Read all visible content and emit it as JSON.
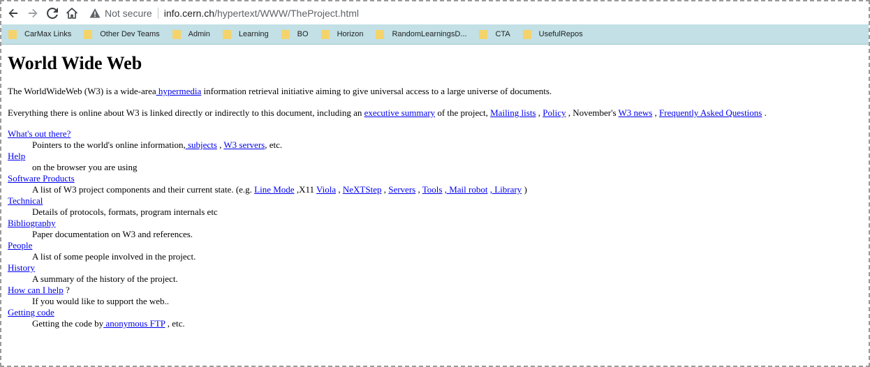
{
  "browser": {
    "security_label": "Not secure",
    "url_host": "info.cern.ch",
    "url_path": "/hypertext/WWW/TheProject.html"
  },
  "bookmarks": [
    {
      "label": "CarMax Links"
    },
    {
      "label": "Other Dev Teams"
    },
    {
      "label": "Admin"
    },
    {
      "label": "Learning"
    },
    {
      "label": "BO"
    },
    {
      "label": "Horizon"
    },
    {
      "label": "RandomLearningsD..."
    },
    {
      "label": "CTA"
    },
    {
      "label": "UsefulRepos"
    }
  ],
  "page": {
    "title": "World Wide Web",
    "intro": {
      "text_a": "The WorldWideWeb (W3) is a wide-area",
      "link_hypermedia": " hypermedia",
      "text_b": " information retrieval initiative aiming to give universal access to a large universe of documents."
    },
    "para2": {
      "text_a": "Everything there is online about W3 is linked directly or indirectly to this document, including an ",
      "link_exec": "executive summary",
      "text_b": " of the project, ",
      "link_mailing": "Mailing lists",
      "text_c": " , ",
      "link_policy": "Policy",
      "text_d": " , November's ",
      "link_news": "W3 news",
      "text_e": " , ",
      "link_faq": "Frequently Asked Questions",
      "text_f": " ."
    },
    "items": {
      "whats_out": {
        "term": "What's out there?",
        "desc_a": "Pointers to the world's online information,",
        "link_subjects": " subjects",
        "desc_b": " , ",
        "link_servers": "W3 servers",
        "desc_c": ", etc."
      },
      "help": {
        "term": "Help",
        "desc": "on the browser you are using"
      },
      "software": {
        "term": "Software Products",
        "desc_a": "A list of W3 project components and their current state. (e.g. ",
        "link_linemode": "Line Mode",
        "desc_b": " ,X11 ",
        "link_viola": "Viola",
        "sep1": " , ",
        "link_nextstep": "NeXTStep",
        "sep2": " , ",
        "link_servers": "Servers",
        "sep3": " , ",
        "link_tools": "Tools",
        "sep4": " ",
        "link_mailrobot": ", Mail robot",
        "sep5": " ",
        "link_library": ", Library",
        "desc_end": " )"
      },
      "technical": {
        "term": "Technical",
        "desc": "Details of protocols, formats, program internals etc"
      },
      "bibliography": {
        "term": "Bibliography",
        "desc": "Paper documentation on W3 and references."
      },
      "people": {
        "term": "People",
        "desc": "A list of some people involved in the project."
      },
      "history": {
        "term": "History",
        "desc": "A summary of the history of the project."
      },
      "howcan": {
        "term": "How can I help",
        "term_suffix": " ?",
        "desc": "If you would like to support the web.."
      },
      "getting": {
        "term": "Getting code",
        "desc_a": "Getting the code by",
        "link_ftp": " anonymous FTP",
        "desc_b": " , etc."
      }
    }
  }
}
